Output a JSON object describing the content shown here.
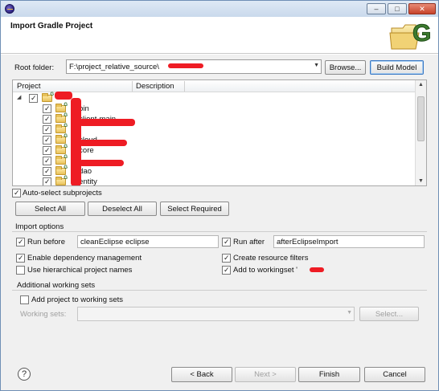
{
  "window": {
    "title": "",
    "controls": {
      "minimize": "–",
      "maximize": "□",
      "close": "✕"
    }
  },
  "banner": {
    "title": "Import Gradle Project",
    "logo_letter": "G"
  },
  "root_folder": {
    "label": "Root folder:",
    "value": "F:\\project_relative_source\\",
    "browse_label": "Browse...",
    "build_model_label": "Build Model"
  },
  "tree": {
    "columns": [
      "Project",
      "Description"
    ],
    "items": [
      {
        "name": "",
        "checked": true,
        "expanded": true,
        "level": 0
      },
      {
        "name": "-bin",
        "checked": true,
        "level": 1
      },
      {
        "name": "-client-main",
        "checked": true,
        "level": 1
      },
      {
        "name": "",
        "checked": true,
        "level": 1
      },
      {
        "name": "-cloud",
        "checked": true,
        "level": 1
      },
      {
        "name": "-core",
        "checked": true,
        "level": 1
      },
      {
        "name": "",
        "checked": true,
        "level": 1
      },
      {
        "name": "-dao",
        "checked": true,
        "level": 1
      },
      {
        "name": "-entity",
        "checked": true,
        "level": 1
      }
    ]
  },
  "auto_select": {
    "label": "Auto-select subprojects",
    "checked": true
  },
  "selection_buttons": {
    "select_all": "Select All",
    "deselect_all": "Deselect All",
    "select_required": "Select Required"
  },
  "import_options": {
    "title": "Import options",
    "run_before": {
      "label": "Run before",
      "checked": true,
      "value": "cleanEclipse eclipse"
    },
    "run_after": {
      "label": "Run after",
      "checked": true,
      "value": "afterEclipseImport"
    },
    "enable_dependency": {
      "label": "Enable dependency management",
      "checked": true
    },
    "create_filters": {
      "label": "Create resource filters",
      "checked": true
    },
    "hierarchical_names": {
      "label": "Use hierarchical project names",
      "checked": false
    },
    "add_to_workingset": {
      "label": "Add to workingset '",
      "checked": true
    }
  },
  "working_sets": {
    "title": "Additional working sets",
    "add_label": "Add project to working sets",
    "add_checked": false,
    "sets_label": "Working sets:",
    "sets_value": "",
    "select_label": "Select..."
  },
  "footer": {
    "back": "< Back",
    "next": "Next >",
    "finish": "Finish",
    "cancel": "Cancel",
    "help": "?"
  },
  "colors": {
    "redaction": "#ee1c24",
    "window_border": "#6f8fb5"
  }
}
